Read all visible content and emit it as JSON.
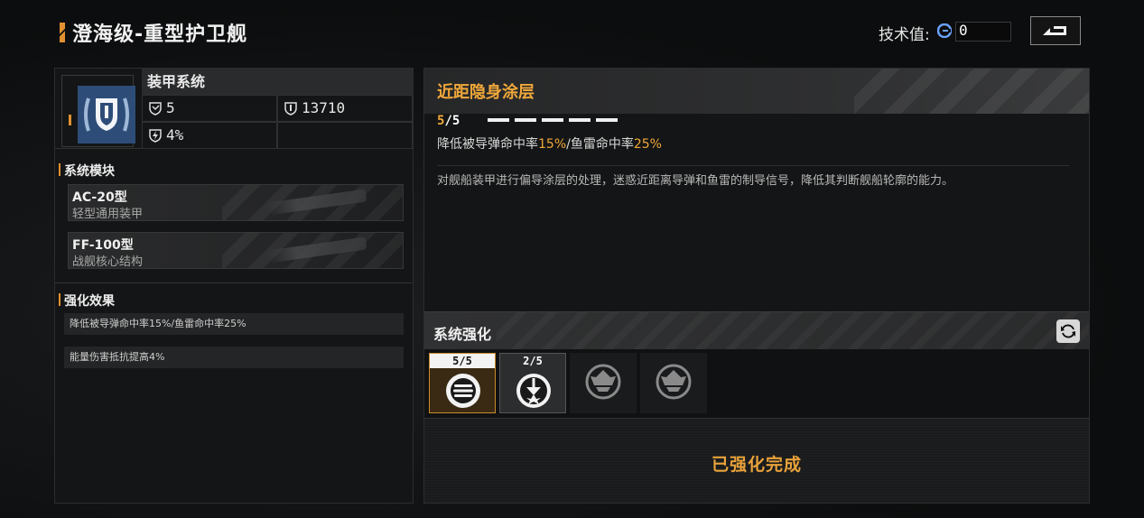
{
  "header": {
    "ship_title": "澄海级-重型护卫舰",
    "tech_label": "技术值:",
    "tech_value": "0"
  },
  "system": {
    "name": "装甲系统",
    "stat_a": "5",
    "stat_b": "13710",
    "stat_c": "4%",
    "stat_d": ""
  },
  "modules_section": {
    "title": "系统模块",
    "items": [
      {
        "name": "AC-20型",
        "desc": "轻型通用装甲"
      },
      {
        "name": "FF-100型",
        "desc": "战舰核心结构"
      }
    ]
  },
  "effects_section": {
    "title": "强化效果",
    "items": [
      "降低被导弹命中率15%/鱼雷命中率25%",
      "能量伤害抵抗提高4%"
    ]
  },
  "detail": {
    "title": "近距隐身涂层",
    "level_current": "5",
    "level_sep_max": "/5",
    "level_progress": 1.0,
    "stat_prefix": "降低被导弹命中率",
    "stat_val1": "15%",
    "stat_mid": "/鱼雷命中率",
    "stat_val2": "25%",
    "description": "对舰船装甲进行偏导涂层的处理，迷惑近距离导弹和鱼雷的制导信号，降低其判断舰船轮廓的能力。"
  },
  "enhance": {
    "title": "系统强化",
    "slots": [
      {
        "level": "5/5",
        "icon": "stripes-circle-icon"
      },
      {
        "level": "2/5",
        "icon": "burst-arrow-icon"
      },
      {
        "level": "",
        "icon": "locked-emblem-icon"
      },
      {
        "level": "",
        "icon": "locked-emblem-icon"
      }
    ],
    "status": "已强化完成"
  },
  "colors": {
    "accent": "#f0a83a",
    "panel": "#141516"
  }
}
